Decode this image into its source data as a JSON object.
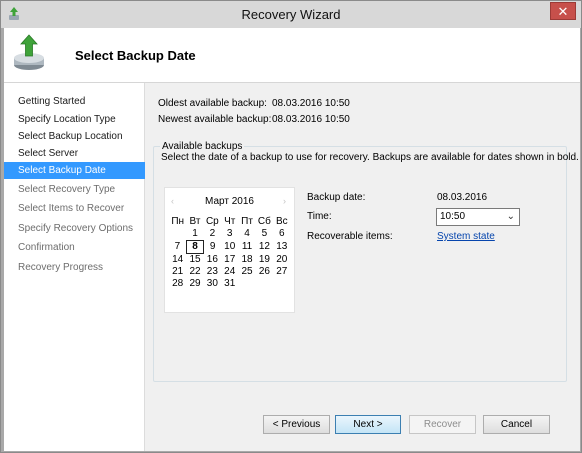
{
  "window": {
    "title": "Recovery Wizard",
    "close_glyph": "✕"
  },
  "header": {
    "title": "Select Backup Date",
    "icon": "backup-restore-icon"
  },
  "nav": {
    "items": [
      {
        "label": "Getting Started",
        "state": "done"
      },
      {
        "label": "Specify Location Type",
        "state": "done"
      },
      {
        "label": "Select Backup Location",
        "state": "done"
      },
      {
        "label": "Select Server",
        "state": "done"
      },
      {
        "label": "Select Backup Date",
        "state": "active"
      },
      {
        "label": "Select Recovery Type",
        "state": "upcoming"
      },
      {
        "label": "Select Items to Recover",
        "state": "upcoming"
      },
      {
        "label": "Specify Recovery Options",
        "state": "upcoming"
      },
      {
        "label": "Confirmation",
        "state": "upcoming"
      },
      {
        "label": "Recovery Progress",
        "state": "upcoming"
      }
    ]
  },
  "info": {
    "oldest_label": "Oldest available backup:",
    "oldest_value": "08.03.2016 10:50",
    "newest_label": "Newest available backup:",
    "newest_value": "08.03.2016 10:50"
  },
  "available": {
    "legend": "Available backups",
    "description": "Select the date of a backup to use for recovery. Backups are available for dates shown in bold."
  },
  "calendar": {
    "month": "Март 2016",
    "prev_glyph": "‹",
    "next_glyph": "›",
    "weekdays": [
      "Пн",
      "Вт",
      "Ср",
      "Чт",
      "Пт",
      "Сб",
      "Вс"
    ],
    "weeks": [
      [
        "",
        "1",
        "2",
        "3",
        "4",
        "5",
        "6"
      ],
      [
        "7",
        "8",
        "9",
        "10",
        "11",
        "12",
        "13"
      ],
      [
        "14",
        "15",
        "16",
        "17",
        "18",
        "19",
        "20"
      ],
      [
        "21",
        "22",
        "23",
        "24",
        "25",
        "26",
        "27"
      ],
      [
        "28",
        "29",
        "30",
        "31",
        "",
        "",
        ""
      ]
    ],
    "selected_day": "8"
  },
  "details": {
    "backup_date_label": "Backup date:",
    "backup_date_value": "08.03.2016",
    "time_label": "Time:",
    "time_value": "10:50",
    "recoverable_label": "Recoverable items:",
    "recoverable_value": "System state"
  },
  "buttons": {
    "previous": "< Previous",
    "next": "Next >",
    "recover": "Recover",
    "cancel": "Cancel"
  },
  "colors": {
    "accent": "#3399ff",
    "link": "#0645ad",
    "close": "#c7504b"
  }
}
